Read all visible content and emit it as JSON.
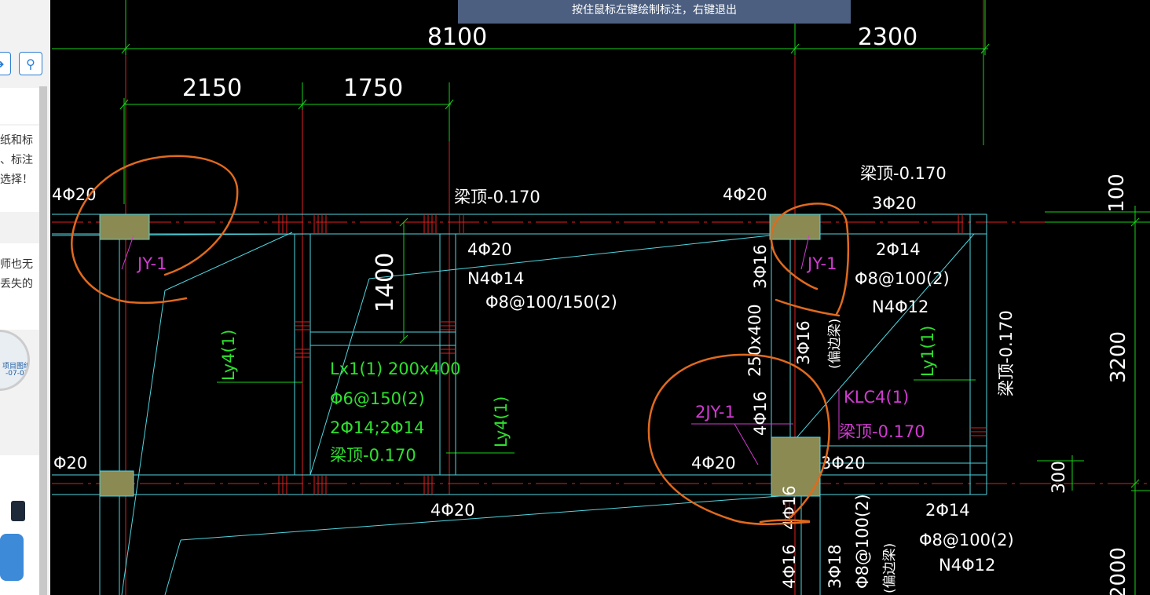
{
  "banner": {
    "text": "按住鼠标左键绘制标注，右键退出"
  },
  "sidebar": {
    "nav_icon": "arrow-icon",
    "search_icon": "search-icon",
    "text_lines": [
      "纸和标",
      "、标注",
      "选择！",
      "师也无",
      "丢失的"
    ],
    "thumb_title": "项目图纸",
    "thumb_date": "-07-07"
  },
  "dims": {
    "d8100": "8100",
    "d2300": "2300",
    "d2150": "2150",
    "d1750": "1750",
    "d1400": "1400",
    "d100": "100",
    "d3200": "3200",
    "d300": "300",
    "d2000": "2000"
  },
  "labels": {
    "top_4phi20_left": "4Φ20",
    "liangding_top_center": "梁顶-0.170",
    "top_4phi20_right": "4Φ20",
    "liangding_top_right": "梁顶-0.170",
    "top_3phi20": "3Φ20",
    "mid_4phi20": "4Φ20",
    "n4phi14": "N4Φ14",
    "stirrup_100_150": "Φ8@100/150(2)",
    "right_2phi14": "2Φ14",
    "stirrup_100_2": "Φ8@100(2)",
    "n4phi12": "N4Φ12",
    "v_3phi16": "3Φ16",
    "v_250x400": "250x400",
    "v_3phi16_b": "3Φ16",
    "v_bianliang": "(偏边梁)",
    "v_4phi16": "4Φ16",
    "left_phi20": "Φ20",
    "bottom_4phi20_center": "4Φ20",
    "bottom_4phi20_right": "4Φ20",
    "bottom_3phi20": "3Φ20",
    "bottom_2phi14": "2Φ14",
    "bottom_stirrup": "Φ8@100(2)",
    "bottom_n4phi12": "N4Φ12",
    "v_4phi16_c": "4Φ16",
    "v_4phi16_d": "4Φ16",
    "v_3phi18": "3Φ18",
    "v_phi8_100_2": "Φ8@100(2)",
    "v_bianliang_2": "(偏边梁)",
    "v_liangding_right": "梁顶-0.170",
    "ly4_left": "Ly4(1)",
    "ly4_right": "Ly4(1)",
    "ly1": "Ly1(1)",
    "lx1_1": "Lx1(1) 200x400",
    "lx1_2": "Φ6@150(2)",
    "lx1_3": "2Φ14;2Φ14",
    "lx1_4": "梁顶-0.170",
    "jy1_left": "JY-1",
    "jy1_right": "JY-1",
    "jy2": "2JY-1",
    "klc4": "KLC4(1)",
    "klc4_ld": "梁顶-0.170"
  },
  "colors": {
    "background": "#000000",
    "dimension_line": "#19d019",
    "beam_outline": "#4fd6e0",
    "axis_red": "#e02020",
    "text_white": "#ffffff",
    "text_green": "#2ee02e",
    "text_magenta": "#d13bd1",
    "column_fill": "#8a8a52",
    "annotation_orange": "#e06a1e",
    "banner": "#4c5f80"
  }
}
